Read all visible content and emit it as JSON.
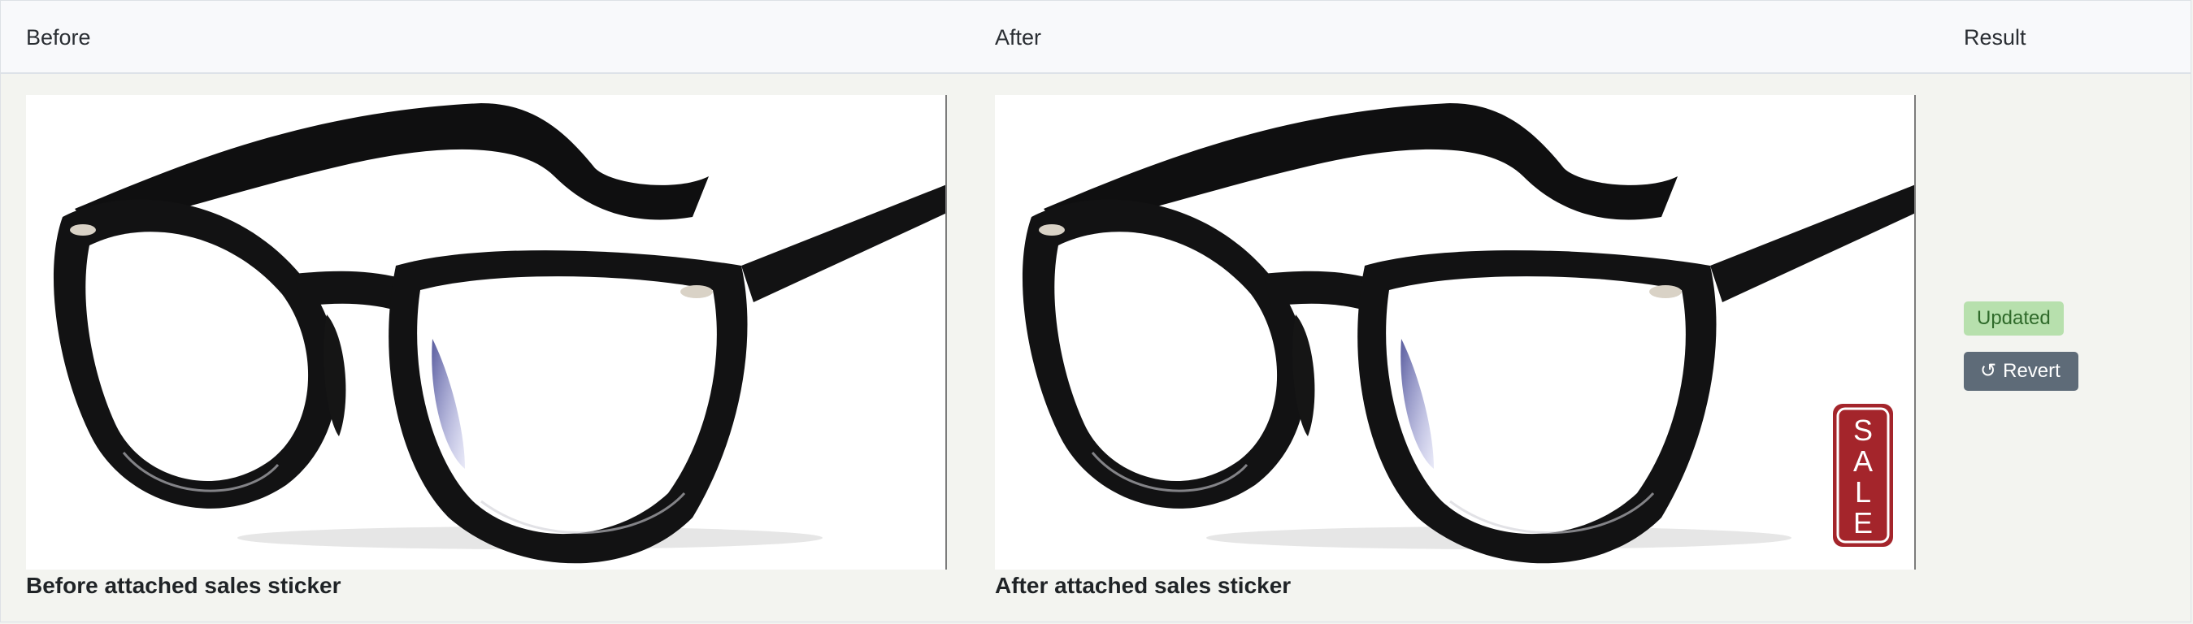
{
  "table": {
    "headers": {
      "before": "Before",
      "after": "After",
      "result": "Result"
    },
    "row": {
      "before_caption": "Before attached sales sticker",
      "after_caption": "After attached sales sticker",
      "status_badge": "Updated",
      "revert_label": "Revert",
      "sticker_text": "SALE"
    }
  },
  "icons": {
    "revert": "undo-icon"
  },
  "colors": {
    "badge_bg": "#b7e0ad",
    "badge_text": "#2f6a2a",
    "button_bg": "#5e6b78",
    "sticker_red": "#a4252b"
  }
}
